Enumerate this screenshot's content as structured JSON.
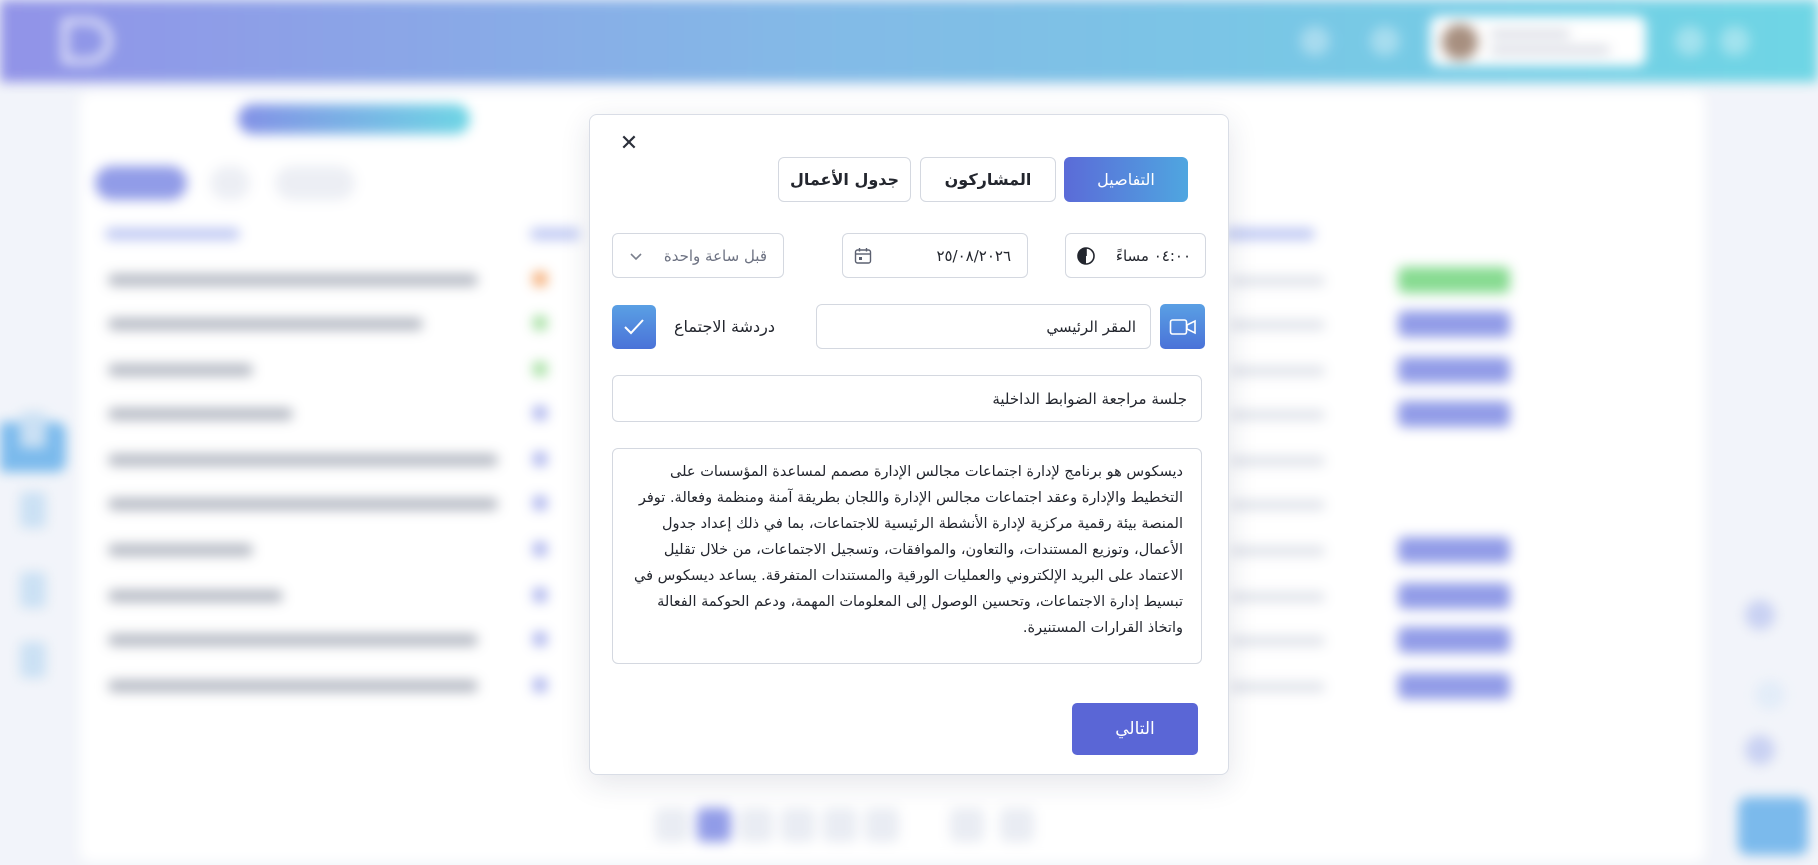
{
  "modal": {
    "close_label": "✕",
    "tabs": [
      {
        "label": "جدول الأعمال",
        "active": false
      },
      {
        "label": "المشاركون",
        "active": false
      },
      {
        "label": "التفاصيل",
        "active": true
      }
    ],
    "time": {
      "value": "٠٤:٠٠ مساءً",
      "icon": "clock-icon"
    },
    "date": {
      "value": "٢٥/٠٨/٢٠٢٦",
      "icon": "calendar-icon"
    },
    "reminder": {
      "selected": "قبل ساعة واحدة",
      "icon": "chevron-down-icon"
    },
    "meeting_chat": {
      "label": "دردشة الاجتماع",
      "checked": true
    },
    "location": {
      "value": "المقر الرئيسي",
      "icon": "video-camera-icon"
    },
    "title_value": "جلسة مراجعة الضوابط الداخلية",
    "description": "ديسكوس هو برنامج لإدارة اجتماعات مجالس الإدارة مصمم لمساعدة المؤسسات على التخطيط والإدارة وعقد اجتماعات مجالس الإدارة واللجان بطريقة آمنة ومنظمة وفعالة. توفر المنصة بيئة رقمية مركزية لإدارة الأنشطة الرئيسية للاجتماعات، بما في ذلك إعداد جدول الأعمال، وتوزيع المستندات، والتعاون، والموافقات، وتسجيل الاجتماعات، من خلال تقليل الاعتماد على البريد الإلكتروني والعمليات الورقية والمستندات المتفرقة. يساعد ديسكوس في تبسيط إدارة الاجتماعات، وتحسين الوصول إلى المعلومات المهمة، ودعم الحوكمة الفعالة واتخاذ القرارات المستنيرة.",
    "next_label": "التالي"
  },
  "colors": {
    "accent": "#5a66d6",
    "tab_active_start": "#5b6bd8",
    "tab_active_end": "#4fa6e0",
    "topbar_start": "#6d6fe0",
    "topbar_end": "#3ec8dc"
  }
}
